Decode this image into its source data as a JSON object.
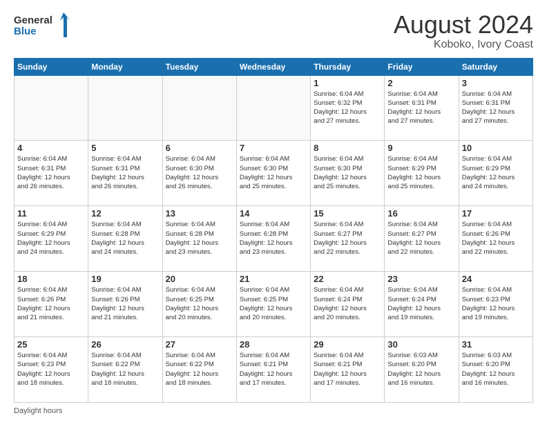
{
  "logo": {
    "line1": "General",
    "line2": "Blue"
  },
  "header": {
    "title": "August 2024",
    "subtitle": "Koboko, Ivory Coast"
  },
  "footer": {
    "text": "Daylight hours"
  },
  "weekdays": [
    "Sunday",
    "Monday",
    "Tuesday",
    "Wednesday",
    "Thursday",
    "Friday",
    "Saturday"
  ],
  "weeks": [
    [
      {
        "day": "",
        "info": ""
      },
      {
        "day": "",
        "info": ""
      },
      {
        "day": "",
        "info": ""
      },
      {
        "day": "",
        "info": ""
      },
      {
        "day": "1",
        "info": "Sunrise: 6:04 AM\nSunset: 6:32 PM\nDaylight: 12 hours\nand 27 minutes."
      },
      {
        "day": "2",
        "info": "Sunrise: 6:04 AM\nSunset: 6:31 PM\nDaylight: 12 hours\nand 27 minutes."
      },
      {
        "day": "3",
        "info": "Sunrise: 6:04 AM\nSunset: 6:31 PM\nDaylight: 12 hours\nand 27 minutes."
      }
    ],
    [
      {
        "day": "4",
        "info": "Sunrise: 6:04 AM\nSunset: 6:31 PM\nDaylight: 12 hours\nand 26 minutes."
      },
      {
        "day": "5",
        "info": "Sunrise: 6:04 AM\nSunset: 6:31 PM\nDaylight: 12 hours\nand 26 minutes."
      },
      {
        "day": "6",
        "info": "Sunrise: 6:04 AM\nSunset: 6:30 PM\nDaylight: 12 hours\nand 26 minutes."
      },
      {
        "day": "7",
        "info": "Sunrise: 6:04 AM\nSunset: 6:30 PM\nDaylight: 12 hours\nand 25 minutes."
      },
      {
        "day": "8",
        "info": "Sunrise: 6:04 AM\nSunset: 6:30 PM\nDaylight: 12 hours\nand 25 minutes."
      },
      {
        "day": "9",
        "info": "Sunrise: 6:04 AM\nSunset: 6:29 PM\nDaylight: 12 hours\nand 25 minutes."
      },
      {
        "day": "10",
        "info": "Sunrise: 6:04 AM\nSunset: 6:29 PM\nDaylight: 12 hours\nand 24 minutes."
      }
    ],
    [
      {
        "day": "11",
        "info": "Sunrise: 6:04 AM\nSunset: 6:29 PM\nDaylight: 12 hours\nand 24 minutes."
      },
      {
        "day": "12",
        "info": "Sunrise: 6:04 AM\nSunset: 6:28 PM\nDaylight: 12 hours\nand 24 minutes."
      },
      {
        "day": "13",
        "info": "Sunrise: 6:04 AM\nSunset: 6:28 PM\nDaylight: 12 hours\nand 23 minutes."
      },
      {
        "day": "14",
        "info": "Sunrise: 6:04 AM\nSunset: 6:28 PM\nDaylight: 12 hours\nand 23 minutes."
      },
      {
        "day": "15",
        "info": "Sunrise: 6:04 AM\nSunset: 6:27 PM\nDaylight: 12 hours\nand 22 minutes."
      },
      {
        "day": "16",
        "info": "Sunrise: 6:04 AM\nSunset: 6:27 PM\nDaylight: 12 hours\nand 22 minutes."
      },
      {
        "day": "17",
        "info": "Sunrise: 6:04 AM\nSunset: 6:26 PM\nDaylight: 12 hours\nand 22 minutes."
      }
    ],
    [
      {
        "day": "18",
        "info": "Sunrise: 6:04 AM\nSunset: 6:26 PM\nDaylight: 12 hours\nand 21 minutes."
      },
      {
        "day": "19",
        "info": "Sunrise: 6:04 AM\nSunset: 6:26 PM\nDaylight: 12 hours\nand 21 minutes."
      },
      {
        "day": "20",
        "info": "Sunrise: 6:04 AM\nSunset: 6:25 PM\nDaylight: 12 hours\nand 20 minutes."
      },
      {
        "day": "21",
        "info": "Sunrise: 6:04 AM\nSunset: 6:25 PM\nDaylight: 12 hours\nand 20 minutes."
      },
      {
        "day": "22",
        "info": "Sunrise: 6:04 AM\nSunset: 6:24 PM\nDaylight: 12 hours\nand 20 minutes."
      },
      {
        "day": "23",
        "info": "Sunrise: 6:04 AM\nSunset: 6:24 PM\nDaylight: 12 hours\nand 19 minutes."
      },
      {
        "day": "24",
        "info": "Sunrise: 6:04 AM\nSunset: 6:23 PM\nDaylight: 12 hours\nand 19 minutes."
      }
    ],
    [
      {
        "day": "25",
        "info": "Sunrise: 6:04 AM\nSunset: 6:23 PM\nDaylight: 12 hours\nand 18 minutes."
      },
      {
        "day": "26",
        "info": "Sunrise: 6:04 AM\nSunset: 6:22 PM\nDaylight: 12 hours\nand 18 minutes."
      },
      {
        "day": "27",
        "info": "Sunrise: 6:04 AM\nSunset: 6:22 PM\nDaylight: 12 hours\nand 18 minutes."
      },
      {
        "day": "28",
        "info": "Sunrise: 6:04 AM\nSunset: 6:21 PM\nDaylight: 12 hours\nand 17 minutes."
      },
      {
        "day": "29",
        "info": "Sunrise: 6:04 AM\nSunset: 6:21 PM\nDaylight: 12 hours\nand 17 minutes."
      },
      {
        "day": "30",
        "info": "Sunrise: 6:03 AM\nSunset: 6:20 PM\nDaylight: 12 hours\nand 16 minutes."
      },
      {
        "day": "31",
        "info": "Sunrise: 6:03 AM\nSunset: 6:20 PM\nDaylight: 12 hours\nand 16 minutes."
      }
    ]
  ]
}
